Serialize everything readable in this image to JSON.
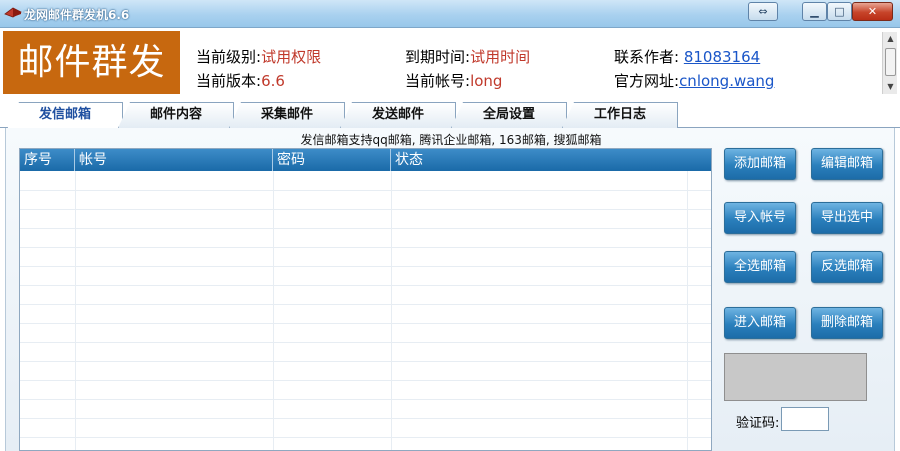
{
  "window": {
    "title": "龙网邮件群发机6.6"
  },
  "header": {
    "logo_text": "邮件群发",
    "level_label": "当前级别:",
    "level_value": "试用权限",
    "version_label": "当前版本:",
    "version_value": "6.6",
    "expire_label": "到期时间:",
    "expire_value": "试用时间",
    "account_label": "当前帐号:",
    "account_value": "long",
    "author_label": "联系作者:",
    "author_value": "81083164",
    "site_label": "官方网址:",
    "site_value": "cnlong.wang"
  },
  "tabs": [
    {
      "label": "发信邮箱",
      "active": true
    },
    {
      "label": "邮件内容",
      "active": false
    },
    {
      "label": "采集邮件",
      "active": false
    },
    {
      "label": "发送邮件",
      "active": false
    },
    {
      "label": "全局设置",
      "active": false
    },
    {
      "label": "工作日志",
      "active": false
    }
  ],
  "notice": "发信邮箱支持qq邮箱, 腾讯企业邮箱, 163邮箱, 搜狐邮箱",
  "table": {
    "columns": [
      "序号",
      "帐号",
      "密码",
      "状态"
    ],
    "rows": []
  },
  "buttons": {
    "add": "添加邮箱",
    "edit": "编辑邮箱",
    "import": "导入帐号",
    "export": "导出选中",
    "select_all": "全选邮箱",
    "invert": "反选邮箱",
    "enter": "进入邮箱",
    "delete": "删除邮箱"
  },
  "captcha": {
    "label": "验证码:",
    "value": ""
  },
  "colors": {
    "logo_bg": "#c7680f",
    "value_red": "#c0392b",
    "header_blue": "#1a6aa8"
  }
}
